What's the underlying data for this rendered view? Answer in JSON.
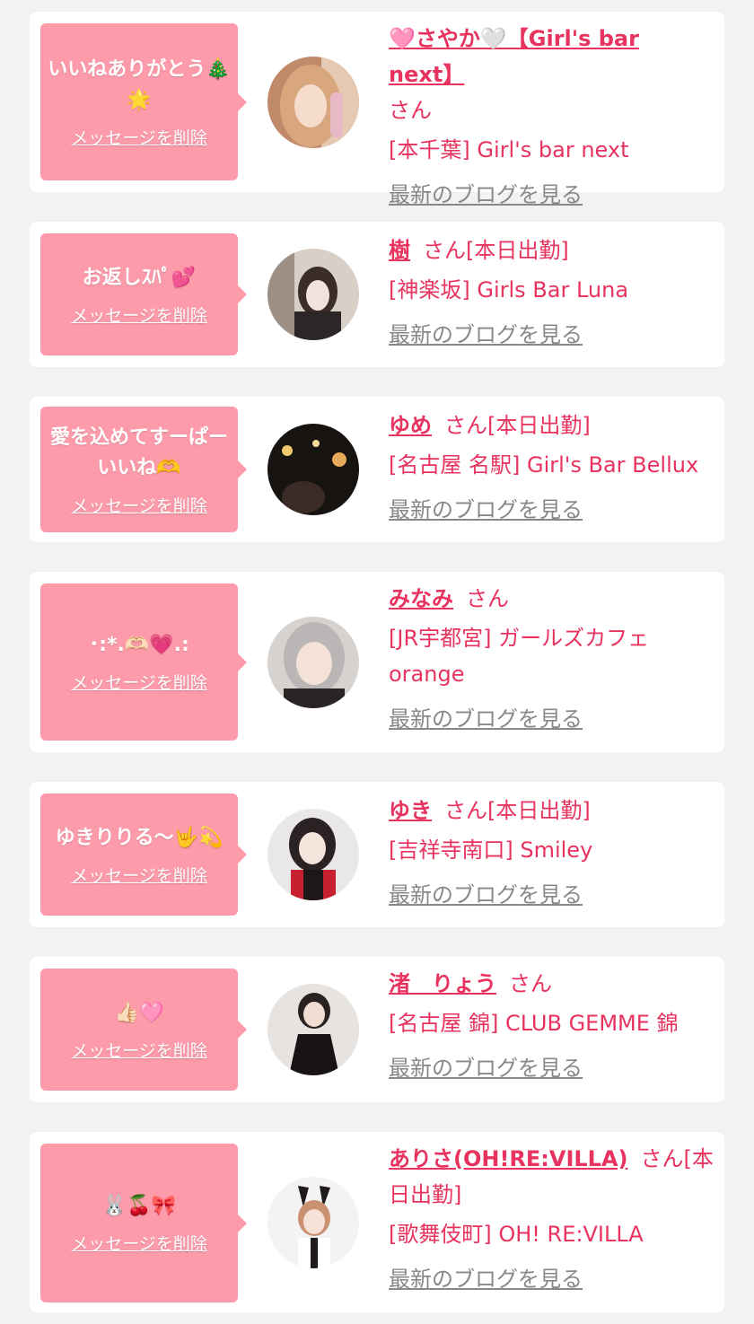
{
  "items": [
    {
      "message": "いいねありがとう🎄🌟",
      "delete_label": "メッセージを削除",
      "name": "🩷さやか🤍【Girl's bar next】",
      "honorific": "さん",
      "shop": "[本千葉] Girl's bar next",
      "blog_label": "最新のブログを見る"
    },
    {
      "message": "お返しｽﾊﾟ💕",
      "delete_label": "メッセージを削除",
      "name": "樹",
      "honorific": "さん[本日出勤]",
      "shop": "[神楽坂] Girls Bar Luna",
      "blog_label": "最新のブログを見る"
    },
    {
      "message": "愛を込めてすーぱーいいね🫶",
      "delete_label": "メッセージを削除",
      "name": "ゆめ",
      "honorific": "さん[本日出勤]",
      "shop": "[名古屋 名駅] Girl's Bar Bellux",
      "blog_label": "最新のブログを見る"
    },
    {
      "message": "･:*.🫶🏻💗.:",
      "delete_label": "メッセージを削除",
      "name": "みなみ",
      "honorific": "さん",
      "shop": "[JR宇都宮] ガールズカフェ orange",
      "blog_label": "最新のブログを見る"
    },
    {
      "message": "ゆきりりる〜🤟💫",
      "delete_label": "メッセージを削除",
      "name": "ゆき",
      "honorific": "さん[本日出勤]",
      "shop": "[吉祥寺南口] Smiley",
      "blog_label": "最新のブログを見る"
    },
    {
      "message": "👍🏻🩷",
      "delete_label": "メッセージを削除",
      "name": "渚　りょう",
      "honorific": "さん",
      "shop": "[名古屋 錦] CLUB GEMME 錦",
      "blog_label": "最新のブログを見る"
    },
    {
      "message": "🐰🍒🎀",
      "delete_label": "メッセージを削除",
      "name": "ありさ(OH!RE:VILLA)",
      "honorific": "さん[本日出勤]",
      "shop": "[歌舞伎町] OH! RE:VILLA",
      "blog_label": "最新のブログを見る"
    }
  ]
}
